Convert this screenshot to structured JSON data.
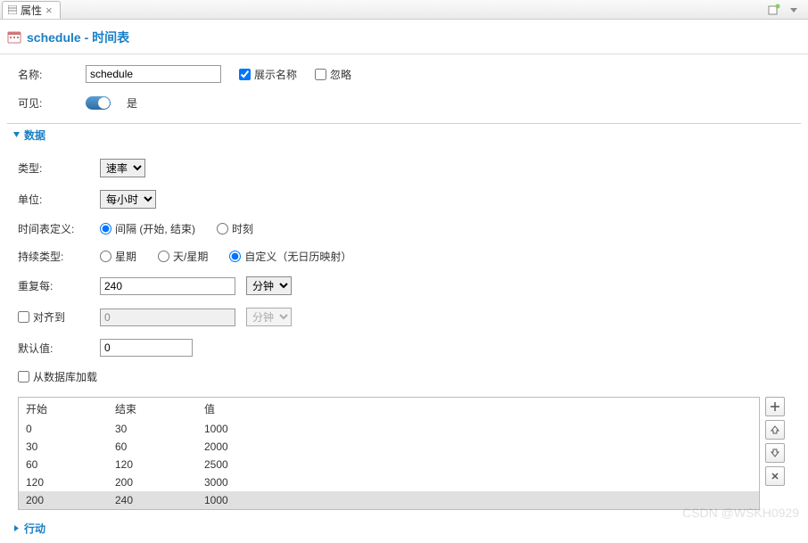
{
  "tab": {
    "label": "属性"
  },
  "header": {
    "title": "schedule - 时间表"
  },
  "general": {
    "name_label": "名称:",
    "name_value": "schedule",
    "show_name_label": "展示名称",
    "show_name_checked": true,
    "ignore_label": "忽略",
    "ignore_checked": false,
    "visible_label": "可见:",
    "visible_value": "是"
  },
  "section_data_label": "数据",
  "data": {
    "type_label": "类型:",
    "type_value": "速率",
    "unit_label": "单位:",
    "unit_value": "每小时",
    "def_label": "时间表定义:",
    "def_interval": "间隔 (开始, 结束)",
    "def_moment": "时刻",
    "dur_label": "持续类型:",
    "dur_week": "星期",
    "dur_day_week": "天/星期",
    "dur_custom": "自定义（无日历映射）",
    "repeat_label": "重复每:",
    "repeat_value": "240",
    "repeat_unit": "分钟",
    "align_label": "对齐到",
    "align_value": "0",
    "align_unit": "分钟",
    "default_label": "默认值:",
    "default_value": "0",
    "loadfromdb_label": "从数据库加载"
  },
  "table": {
    "headers": {
      "start": "开始",
      "end": "结束",
      "value": "值"
    },
    "rows": [
      {
        "start": "0",
        "end": "30",
        "value": "1000"
      },
      {
        "start": "30",
        "end": "60",
        "value": "2000"
      },
      {
        "start": "60",
        "end": "120",
        "value": "2500"
      },
      {
        "start": "120",
        "end": "200",
        "value": "3000"
      },
      {
        "start": "200",
        "end": "240",
        "value": "1000"
      }
    ],
    "selected_index": 4
  },
  "section_action_label": "行动",
  "watermark": "CSDN @WSKH0929"
}
